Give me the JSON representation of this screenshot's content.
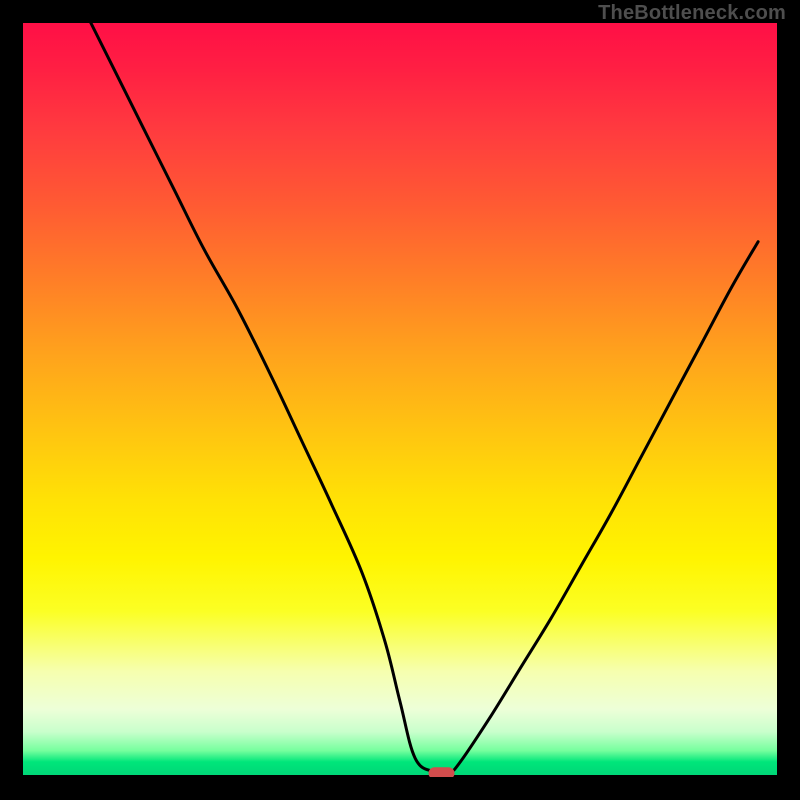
{
  "attribution": "TheBottleneck.com",
  "chart_data": {
    "type": "line",
    "title": "",
    "xlabel": "",
    "ylabel": "",
    "xlim": [
      0,
      100
    ],
    "ylim": [
      0,
      100
    ],
    "legend": false,
    "grid": false,
    "background_gradient": [
      "#ff0f46",
      "#ff7e27",
      "#ffe106",
      "#f6ffaf",
      "#00d477"
    ],
    "series": [
      {
        "name": "bottleneck-curve",
        "x": [
          9,
          12,
          16,
          20,
          24,
          28.5,
          33,
          37,
          41,
          45,
          48,
          50,
          52,
          54.5,
          56.5,
          58,
          62,
          66,
          70,
          74,
          78,
          82,
          86,
          90,
          94,
          97.5
        ],
        "y": [
          100,
          94,
          86,
          78,
          70,
          62,
          53,
          44.5,
          36,
          27,
          18,
          10,
          2.5,
          0.7,
          0.6,
          2,
          8,
          14.5,
          21,
          28,
          35,
          42.5,
          50,
          57.5,
          65,
          71
        ]
      }
    ],
    "marker": {
      "x": 55.5,
      "y": 0.5,
      "color": "#d14d4d"
    }
  }
}
